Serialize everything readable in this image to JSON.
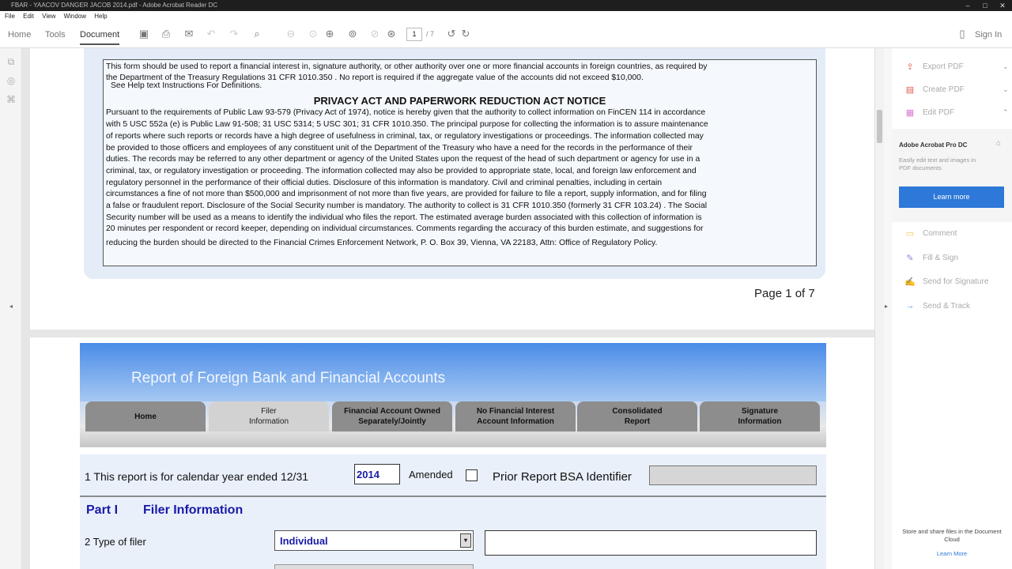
{
  "window": {
    "title": "FBAR - YAACOV DANGER JACOB 2014.pdf - Adobe Acrobat Reader DC"
  },
  "menubar": [
    "File",
    "Edit",
    "View",
    "Window",
    "Help"
  ],
  "toolbar": {
    "tabs": [
      "Home",
      "Tools",
      "Document"
    ],
    "active_tab": "Document",
    "page_current": "1",
    "page_total": "/ 7",
    "signin_label": "Sign In"
  },
  "page1": {
    "intro_line1": "This form should be used to report a financial interest in, signature authority, or other authority over one or more financial accounts in foreign countries, as required by",
    "intro_line2": "the Department of the Treasury Regulations 31 CFR 1010.350 . No report is required if the aggregate value of the accounts did not exceed $10,000.",
    "intro_line3": "See Help text Instructions For Definitions.",
    "notice_title": "PRIVACY ACT AND PAPERWORK REDUCTION ACT NOTICE",
    "notice_lines": [
      "Pursuant to the requirements of Public Law 93-579 (Privacy Act of 1974), notice is hereby given that the authority to collect information on FinCEN 114 in accordance",
      "with 5 USC 552a (e) is Public Law 91-508; 31 USC 5314; 5 USC 301; 31 CFR 1010.350. The principal purpose for collecting the information is to assure maintenance",
      "of reports where such reports or records have a high degree of usefulness in criminal, tax, or regulatory investigations or proceedings. The information collected may",
      "be provided to those officers and employees of any constituent unit of the Department of the Treasury who have a need for the records in the performance of their",
      "duties. The records may be referred to any other department or agency of the United States upon the request of the head of such department or agency for use in a",
      "criminal, tax, or regulatory investigation or proceeding. The information collected may also be provided to appropriate state, local, and foreign law enforcement and",
      "regulatory personnel in the performance of their official duties. Disclosure of this information is mandatory. Civil and criminal penalties, including in certain",
      "circumstances a fine of not more than $500,000 and imprisonment of not more than five years, are provided for failure to file a report, supply information, and for filing",
      "a false or fraudulent report. Disclosure of the Social Security number is mandatory. The authority to collect is 31 CFR 1010.350 (formerly 31 CFR 103.24) . The Social",
      "Security number will be used as a means to identify the individual who files the report. The estimated average burden associated with this collection of information is",
      "20 minutes per respondent or record keeper, depending on individual circumstances. Comments regarding the accuracy of this burden estimate, and suggestions for",
      "reducing the burden should be directed to the Financial Crimes Enforcement Network, P. O. Box 39, Vienna, VA 22183, Attn: Office of Regulatory Policy."
    ],
    "page_label": "Page 1 of 7"
  },
  "form": {
    "title": "Report of Foreign Bank and Financial Accounts",
    "tabs": [
      "Home",
      "Filer\nInformation",
      "Financial Account Owned\nSeparately/Jointly",
      "No Financial Interest\nAccount Information",
      "Consolidated\nReport",
      "Signature\nInformation"
    ],
    "row1_label": "1  This report is for calendar year ended 12/31",
    "year_value": "2014",
    "amended_label": "Amended",
    "prior_bsa_label": "Prior Report BSA Identifier",
    "part_label": "Part I",
    "part_title": "Filer Information",
    "row2_label": "2 Type of filer",
    "filer_type_value": "Individual"
  },
  "right_pane": {
    "tools": [
      {
        "label": "Export PDF",
        "icon": "export-pdf-icon",
        "glyph": "⇪",
        "color": "#e05c4b"
      },
      {
        "label": "Create PDF",
        "icon": "create-pdf-icon",
        "glyph": "▤",
        "color": "#e05c4b"
      },
      {
        "label": "Edit PDF",
        "icon": "edit-pdf-icon",
        "glyph": "▦",
        "color": "#d77ad2"
      }
    ],
    "promo_title": "Adobe Acrobat Pro DC",
    "promo_desc": "Easily edit text and images in PDF documents",
    "promo_button": "Learn more",
    "more_tools": [
      {
        "label": "Comment",
        "icon": "comment-icon",
        "glyph": "▭",
        "color": "#f3c64a"
      },
      {
        "label": "Fill & Sign",
        "icon": "fill-sign-icon",
        "glyph": "✎",
        "color": "#8a88d8"
      },
      {
        "label": "Send for Signature",
        "icon": "send-signature-icon",
        "glyph": "✍",
        "color": "#8a88d8"
      },
      {
        "label": "Send & Track",
        "icon": "send-track-icon",
        "glyph": "→",
        "color": "#4a8ce8"
      }
    ],
    "cloud_text": "Store and share files in the Document Cloud",
    "cloud_link": "Learn More"
  },
  "colors": {
    "accent": "#2d78d8",
    "form_blue": "#1a1aa8"
  }
}
